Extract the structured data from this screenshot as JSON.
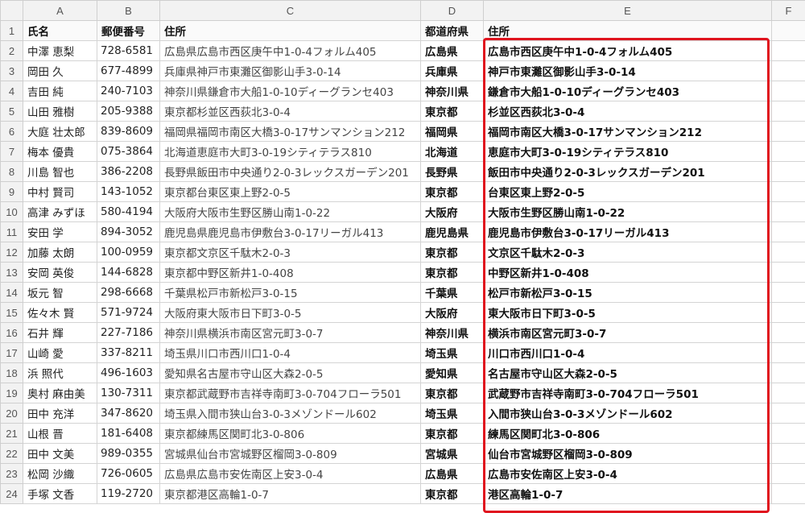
{
  "col_headers": [
    "A",
    "B",
    "C",
    "D",
    "E",
    "F"
  ],
  "row_numbers": [
    "1",
    "2",
    "3",
    "4",
    "5",
    "6",
    "7",
    "8",
    "9",
    "10",
    "11",
    "12",
    "13",
    "14",
    "15",
    "16",
    "17",
    "18",
    "19",
    "20",
    "21",
    "22",
    "23",
    "24"
  ],
  "header": {
    "name": "氏名",
    "zip": "郵便番号",
    "address": "住所",
    "pref": "都道府県",
    "result": "住所"
  },
  "rows": [
    {
      "name": "中澤 恵梨",
      "zip": "728-6581",
      "address": "広島県広島市西区庚午中1-0-4フォルム405",
      "pref": "広島県",
      "result": "広島市西区庚午中1-0-4フォルム405"
    },
    {
      "name": "岡田 久",
      "zip": "677-4899",
      "address": "兵庫県神戸市東灘区御影山手3-0-14",
      "pref": "兵庫県",
      "result": "神戸市東灘区御影山手3-0-14"
    },
    {
      "name": "吉田 純",
      "zip": "240-7103",
      "address": "神奈川県鎌倉市大船1-0-10ディーグランセ403",
      "pref": "神奈川県",
      "result": "鎌倉市大船1-0-10ディーグランセ403"
    },
    {
      "name": "山田 雅樹",
      "zip": "205-9388",
      "address": "東京都杉並区西荻北3-0-4",
      "pref": "東京都",
      "result": "杉並区西荻北3-0-4"
    },
    {
      "name": "大庭 壮太郎",
      "zip": "839-8609",
      "address": "福岡県福岡市南区大橋3-0-17サンマンション212",
      "pref": "福岡県",
      "result": "福岡市南区大橋3-0-17サンマンション212"
    },
    {
      "name": "梅本 優貴",
      "zip": "075-3864",
      "address": "北海道恵庭市大町3-0-19シティテラス810",
      "pref": "北海道",
      "result": "恵庭市大町3-0-19シティテラス810"
    },
    {
      "name": "川島 智也",
      "zip": "386-2208",
      "address": "長野県飯田市中央通り2-0-3レックスガーデン201",
      "pref": "長野県",
      "result": "飯田市中央通り2-0-3レックスガーデン201"
    },
    {
      "name": "中村 賢司",
      "zip": "143-1052",
      "address": "東京都台東区東上野2-0-5",
      "pref": "東京都",
      "result": "台東区東上野2-0-5"
    },
    {
      "name": "高津 みずほ",
      "zip": "580-4194",
      "address": "大阪府大阪市生野区勝山南1-0-22",
      "pref": "大阪府",
      "result": "大阪市生野区勝山南1-0-22"
    },
    {
      "name": "安田 学",
      "zip": "894-3052",
      "address": "鹿児島県鹿児島市伊敷台3-0-17リーガル413",
      "pref": "鹿児島県",
      "result": "鹿児島市伊敷台3-0-17リーガル413"
    },
    {
      "name": "加藤 太朗",
      "zip": "100-0959",
      "address": "東京都文京区千駄木2-0-3",
      "pref": "東京都",
      "result": "文京区千駄木2-0-3"
    },
    {
      "name": "安岡 英俊",
      "zip": "144-6828",
      "address": "東京都中野区新井1-0-408",
      "pref": "東京都",
      "result": "中野区新井1-0-408"
    },
    {
      "name": "坂元 智",
      "zip": "298-6668",
      "address": "千葉県松戸市新松戸3-0-15",
      "pref": "千葉県",
      "result": "松戸市新松戸3-0-15"
    },
    {
      "name": "佐々木 賢",
      "zip": "571-9724",
      "address": "大阪府東大阪市日下町3-0-5",
      "pref": "大阪府",
      "result": "東大阪市日下町3-0-5"
    },
    {
      "name": "石井 輝",
      "zip": "227-7186",
      "address": "神奈川県横浜市南区宮元町3-0-7",
      "pref": "神奈川県",
      "result": "横浜市南区宮元町3-0-7"
    },
    {
      "name": "山崎 愛",
      "zip": "337-8211",
      "address": "埼玉県川口市西川口1-0-4",
      "pref": "埼玉県",
      "result": "川口市西川口1-0-4"
    },
    {
      "name": "浜 照代",
      "zip": "496-1603",
      "address": "愛知県名古屋市守山区大森2-0-5",
      "pref": "愛知県",
      "result": "名古屋市守山区大森2-0-5"
    },
    {
      "name": "奥村 麻由美",
      "zip": "130-7311",
      "address": "東京都武蔵野市吉祥寺南町3-0-704フローラ501",
      "pref": "東京都",
      "result": "武蔵野市吉祥寺南町3-0-704フローラ501"
    },
    {
      "name": "田中 充洋",
      "zip": "347-8620",
      "address": "埼玉県入間市狭山台3-0-3メゾンドール602",
      "pref": "埼玉県",
      "result": "入間市狭山台3-0-3メゾンドール602"
    },
    {
      "name": "山根 晋",
      "zip": "181-6408",
      "address": "東京都練馬区関町北3-0-806",
      "pref": "東京都",
      "result": "練馬区関町北3-0-806"
    },
    {
      "name": "田中 文美",
      "zip": "989-0355",
      "address": "宮城県仙台市宮城野区榴岡3-0-809",
      "pref": "宮城県",
      "result": "仙台市宮城野区榴岡3-0-809"
    },
    {
      "name": "松岡 沙織",
      "zip": "726-0605",
      "address": "広島県広島市安佐南区上安3-0-4",
      "pref": "広島県",
      "result": "広島市安佐南区上安3-0-4"
    },
    {
      "name": "手塚 文香",
      "zip": "119-2720",
      "address": "東京都港区高輪1-0-7",
      "pref": "東京都",
      "result": "港区高輪1-0-7"
    }
  ],
  "highlight_color": "#e0141e"
}
